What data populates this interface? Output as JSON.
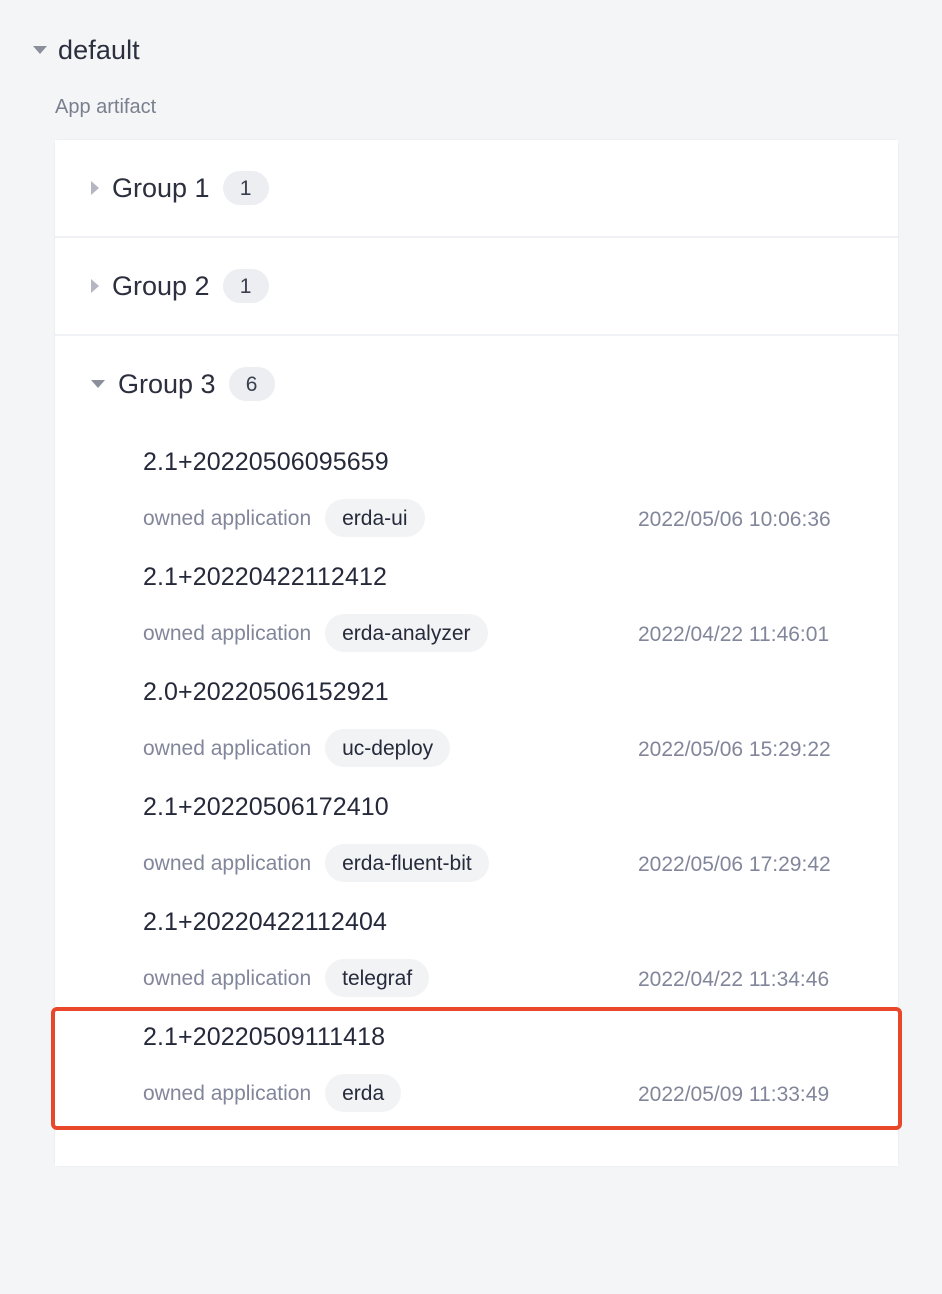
{
  "section": {
    "title": "default",
    "subtitle": "App artifact",
    "toggle_icon": "caret-down-icon"
  },
  "groups": [
    {
      "label": "Group 1",
      "count": "1",
      "expanded": false,
      "toggle_icon": "caret-right-icon",
      "items": []
    },
    {
      "label": "Group 2",
      "count": "1",
      "expanded": false,
      "toggle_icon": "caret-right-icon",
      "items": []
    },
    {
      "label": "Group 3",
      "count": "6",
      "expanded": true,
      "toggle_icon": "caret-down-icon",
      "items": [
        {
          "version": "2.1+20220506095659",
          "meta_label": "owned application",
          "app": "erda-ui",
          "time": "2022/05/06 10:06:36",
          "selected": false
        },
        {
          "version": "2.1+20220422112412",
          "meta_label": "owned application",
          "app": "erda-analyzer",
          "time": "2022/04/22 11:46:01",
          "selected": false
        },
        {
          "version": "2.0+20220506152921",
          "meta_label": "owned application",
          "app": "uc-deploy",
          "time": "2022/05/06 15:29:22",
          "selected": false
        },
        {
          "version": "2.1+20220506172410",
          "meta_label": "owned application",
          "app": "erda-fluent-bit",
          "time": "2022/05/06 17:29:42",
          "selected": false
        },
        {
          "version": "2.1+20220422112404",
          "meta_label": "owned application",
          "app": "telegraf",
          "time": "2022/04/22 11:34:46",
          "selected": false
        },
        {
          "version": "2.1+20220509111418",
          "meta_label": "owned application",
          "app": "erda",
          "time": "2022/05/09 11:33:49",
          "selected": true
        }
      ]
    }
  ],
  "colors": {
    "page_background": "#f4f5f7",
    "card_background": "#ffffff",
    "title_text": "#2b2f3e",
    "muted_text": "#82869a",
    "badge_background": "#eceef1",
    "tag_background": "#f2f3f5",
    "selection_outline": "#e8472a",
    "caret_collapsed": "#b4b7c2",
    "caret_expanded": "#8b8f9c"
  }
}
